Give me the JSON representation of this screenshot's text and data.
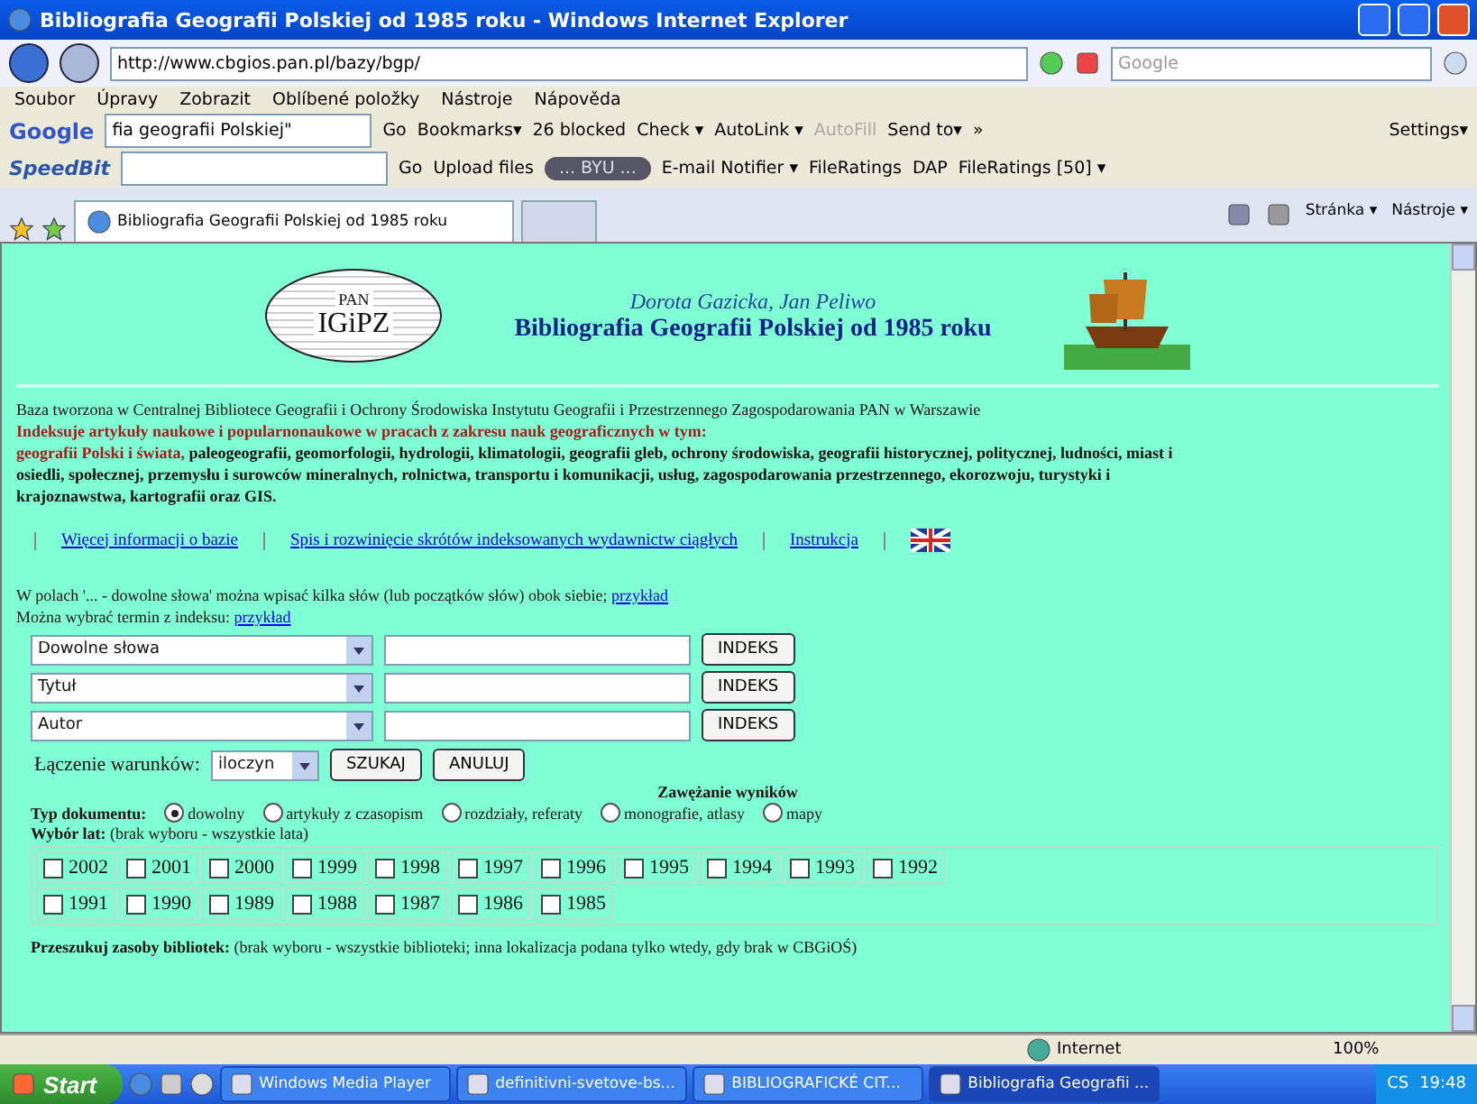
{
  "window": {
    "title": "Bibliografia Geografii Polskiej od 1985 roku - Windows Internet Explorer"
  },
  "nav": {
    "address": "http://www.cbgios.pan.pl/bazy/bgp/",
    "search_placeholder": "Google"
  },
  "menu": [
    "Soubor",
    "Úpravy",
    "Zobrazit",
    "Oblíbené položky",
    "Nástroje",
    "Nápověda"
  ],
  "google_toolbar": {
    "search_value": "fia geografii Polskiej\"",
    "items": [
      {
        "label": "Go",
        "disabled": false
      },
      {
        "label": "Bookmarks▾",
        "disabled": false
      },
      {
        "label": "26 blocked",
        "disabled": false
      },
      {
        "label": "Check ▾",
        "disabled": false
      },
      {
        "label": "AutoLink ▾",
        "disabled": false
      },
      {
        "label": "AutoFill",
        "disabled": true
      },
      {
        "label": "Send to▾",
        "disabled": false
      },
      {
        "label": "»",
        "disabled": false
      }
    ],
    "brand": "Google",
    "settings": "Settings▾"
  },
  "speedbit_toolbar": {
    "brand": "SpeedBit",
    "items": [
      "Go",
      "Upload files",
      "E-mail Notifier ▾",
      "FileRatings",
      "DAP",
      "FileRatings [50] ▾"
    ],
    "player": "... BYU ..."
  },
  "tabs": [
    {
      "label": "Bibliografia Geografii Polskiej od 1985 roku",
      "selected": true
    },
    {
      "selected": false
    }
  ],
  "commands": [
    "Stránka ▾",
    "Nástroje ▾"
  ],
  "page": {
    "logo_top": "PAN",
    "logo_main": "IGiPZ",
    "authors": "Dorota Gazicka, Jan Peliwo",
    "title": "Bibliografia Geografii Polskiej od 1985 roku",
    "intro": "Baza tworzona w Centralnej Bibliotece Geografii i Ochrony Środowiska Instytutu Geografii i Przestrzennego Zagospodarowania PAN w Warszawie",
    "scope": "Indeksuje artykuły naukowe i popularnonaukowe w pracach z zakresu nauk geograficznych w tym:",
    "topics_lead": "geografii Polski i świata,",
    "topics": "paleogeografii, geomorfologii, hydrologii, klimatologii, geografii gleb, ochrony środowiska, geografii historycznej, politycznej, ludności, miast i osiedli, społecznej, przemysłu i surowców mineralnych, rolnictwa, transportu i komunikacji, usług, zagospodarowania przestrzennego, ekorozwoju, turystyki i krajoznawstwa, kartografii oraz GIS.",
    "links": [
      "Więcej informacji o bazie",
      "Spis i rozwinięcie skrótów indeksowanych wydawnictw ciągłych",
      "Instrukcja"
    ],
    "hint1": "W polach '... - dowolne słowa' można wpisać kilka słów (lub początków słów) obok siebie;",
    "hint1_link": "przykład",
    "hint2": "Można wybrać termin z indeksu:",
    "hint2_link": "przykład",
    "search_rows": [
      {
        "field": "Dowolne słowa",
        "button": "INDEKS"
      },
      {
        "field": "Tytuł",
        "button": "INDEKS"
      },
      {
        "field": "Autor",
        "button": "INDEKS"
      }
    ],
    "combine": {
      "label": "Łączenie warunków:",
      "value": "iloczyn",
      "buttons": [
        "SZUKAJ",
        "ANULUJ"
      ]
    },
    "narrow_title": "Zawężanie wyników",
    "doc_type": {
      "label": "Typ dokumentu:",
      "options": [
        {
          "label": "dowolny",
          "selected": true
        },
        {
          "label": "artykuły z czasopism",
          "selected": false
        },
        {
          "label": "rozdziały, referaty",
          "selected": false
        },
        {
          "label": "monografie, atlasy",
          "selected": false
        },
        {
          "label": "mapy",
          "selected": false
        }
      ]
    },
    "years": {
      "label": "Wybór lat:",
      "note": "(brak wyboru - wszystkie lata)",
      "items": [
        {
          "label": "2002",
          "checked": false
        },
        {
          "label": "2001",
          "checked": false
        },
        {
          "label": "2000",
          "checked": false
        },
        {
          "label": "1999",
          "checked": false
        },
        {
          "label": "1998",
          "checked": false
        },
        {
          "label": "1997",
          "checked": false
        },
        {
          "label": "1996",
          "checked": false
        },
        {
          "label": "1995",
          "checked": false
        },
        {
          "label": "1994",
          "checked": false
        },
        {
          "label": "1993",
          "checked": false
        },
        {
          "label": "1992",
          "checked": false
        },
        {
          "label": "1991",
          "checked": false
        },
        {
          "label": "1990",
          "checked": false
        },
        {
          "label": "1989",
          "checked": false
        },
        {
          "label": "1988",
          "checked": false
        },
        {
          "label": "1987",
          "checked": false
        },
        {
          "label": "1986",
          "checked": false
        },
        {
          "label": "1985",
          "checked": false
        }
      ]
    },
    "libraries": {
      "label": "Przeszukuj zasoby bibliotek:",
      "note": "(brak wyboru - wszystkie biblioteki; inna lokalizacja podana tylko wtedy, gdy brak w CBGiOŚ)"
    }
  },
  "status": {
    "zone": "Internet",
    "zoom": "100%"
  },
  "taskbar": {
    "start": "Start",
    "tasks": [
      {
        "label": "Windows Media Player",
        "selected": false
      },
      {
        "label": "definitivni-svetove-bs...",
        "selected": false
      },
      {
        "label": "BIBLIOGRAFICKÉ CIT...",
        "selected": false
      },
      {
        "label": "Bibliografia Geografii ...",
        "selected": true
      }
    ],
    "lang": "CS",
    "clock": "19:48"
  }
}
